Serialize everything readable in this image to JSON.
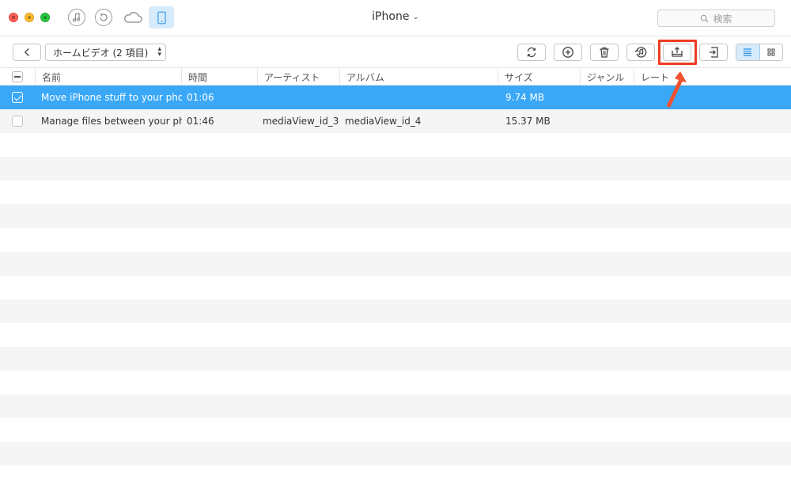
{
  "titlebar": {
    "device_name": "iPhone",
    "device_chevron": "⌄",
    "search_placeholder": "検索",
    "mode_icons": [
      "music-icon",
      "restore-icon",
      "cloud-icon",
      "device-icon"
    ]
  },
  "toolbar": {
    "category_label": "ホームビデオ (2 項目)",
    "buttons": [
      "refresh-icon",
      "add-icon",
      "trash-icon",
      "itunes-icon",
      "export-to-computer-icon",
      "import-icon"
    ],
    "view_modes": [
      "list-view-icon",
      "grid-view-icon"
    ]
  },
  "colors": {
    "selection": "#3aa8f7",
    "highlight": "#ef3b24",
    "active_bg": "#d6ebfb"
  },
  "table": {
    "columns": [
      "名前",
      "時間",
      "アーティスト",
      "アルバム",
      "サイズ",
      "ジャンル",
      "レート"
    ],
    "rows": [
      {
        "name": "Move iPhone stuff to your pho…",
        "time": "01:06",
        "artist": "",
        "album": "",
        "size": "9.74 MB",
        "genre": "",
        "rate": "",
        "selected": true
      },
      {
        "name": "Manage files between your ph…",
        "time": "01:46",
        "artist": "mediaView_id_3",
        "album": "mediaView_id_4",
        "size": "15.37 MB",
        "genre": "",
        "rate": "",
        "selected": false
      }
    ]
  }
}
